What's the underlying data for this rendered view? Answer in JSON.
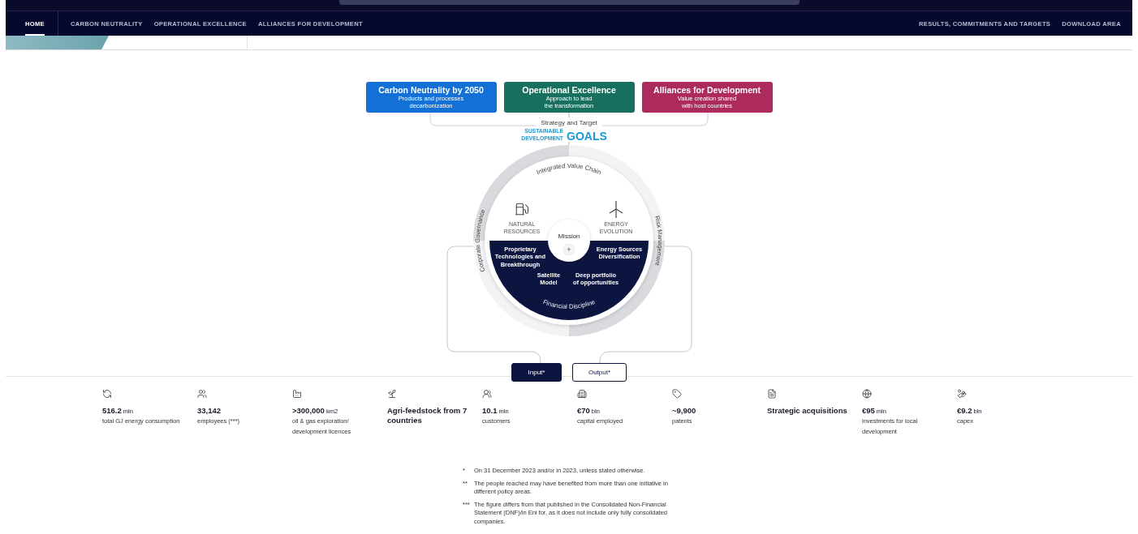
{
  "nav": {
    "left": [
      {
        "label": "HOME",
        "selected": true
      },
      {
        "label": "CARBON NEUTRALITY",
        "selected": false
      },
      {
        "label": "OPERATIONAL EXCELLENCE",
        "selected": false
      },
      {
        "label": "ALLIANCES FOR DEVELOPMENT",
        "selected": false
      }
    ],
    "right": [
      {
        "label": "RESULTS, COMMITMENTS AND TARGETS",
        "selected": false
      },
      {
        "label": "DOWNLOAD AREA",
        "selected": false
      }
    ]
  },
  "pillars": [
    {
      "title": "Carbon Neutrality by 2050",
      "lines": [
        "Products and processes",
        "decarbonization"
      ],
      "color": "#1270d6"
    },
    {
      "title": "Operational Excellence",
      "lines": [
        "Approach to lead",
        "the transformation"
      ],
      "color": "#17705f"
    },
    {
      "title": "Alliances for Development",
      "lines": [
        "Value creation shared",
        "with host countries"
      ],
      "color": "#ad2a5c"
    }
  ],
  "strategy_label": "Strategy and Target",
  "sdg_logo": {
    "small": [
      "SUSTAINABLE",
      "DEVELOPMENT"
    ],
    "big": "GOALS"
  },
  "wheel": {
    "top_arc": "Integrated Value Chain",
    "bottom_arc": "Financial Discipline",
    "left_arc": "Corporate Governance",
    "right_arc": "Risk Management",
    "center": {
      "title": "Mission",
      "mark": "+"
    },
    "upper_left": [
      "NATURAL",
      "RESOURCES"
    ],
    "upper_right": [
      "ENERGY",
      "EVOLUTION"
    ],
    "lower": [
      [
        "Proprietary",
        "Technologies and",
        "Breakthrough"
      ],
      [
        "Satellite",
        "Model"
      ],
      [
        "Deep portfolio",
        "of opportunities"
      ],
      [
        "Energy Sources",
        "Diversification"
      ]
    ]
  },
  "toggle": [
    {
      "label": "Input*",
      "selected": true
    },
    {
      "label": "Output*",
      "selected": false
    }
  ],
  "metrics": [
    {
      "value": "516.2",
      "unit": "mln",
      "label": [
        "total GJ energy consumption"
      ]
    },
    {
      "value": "33,142",
      "label": [
        "employees (***)"
      ]
    },
    {
      "value": ">300,000",
      "unit": "km2",
      "label": [
        "oil & gas exploration/",
        "development licences"
      ]
    },
    {
      "value": "Agri-feedstock from 7 countries"
    },
    {
      "value": "10.1",
      "unit": "mln",
      "label": [
        "customers"
      ]
    },
    {
      "value": "€70",
      "unit": "bln",
      "label": [
        "capital employed"
      ]
    },
    {
      "value": "~9,900",
      "label": [
        "patents"
      ]
    },
    {
      "value": "Strategic acquisitions"
    },
    {
      "value": "€95",
      "unit": "mln",
      "label": [
        "investments for local",
        "development"
      ]
    },
    {
      "value": "€9.2",
      "unit": "bln",
      "label": [
        "capex"
      ]
    }
  ],
  "footnotes": [
    {
      "mark": "*",
      "text": "On 31 December 2023 and/or in 2023, unless stated otherwise."
    },
    {
      "mark": "**",
      "text": "The people reached may have benefited from more than one initiative in different policy areas."
    },
    {
      "mark": "***",
      "text": "The figure differs from that published in the Consolidated Non-Financial Statement (DNF)/in Eni for, as it does not include only fully consolidated companies."
    }
  ]
}
